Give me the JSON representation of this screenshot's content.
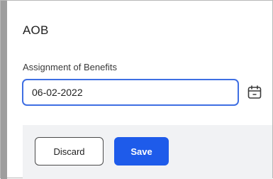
{
  "section": {
    "title": "AOB"
  },
  "field": {
    "label": "Assignment of Benefits",
    "value": "06-02-2022"
  },
  "actions": {
    "discard_label": "Discard",
    "save_label": "Save"
  },
  "colors": {
    "accent": "#1e5bea",
    "input_border": "#3f6fe3",
    "footer_bg": "#f1f2f4"
  },
  "icons": {
    "date_picker": "calendar-icon"
  }
}
